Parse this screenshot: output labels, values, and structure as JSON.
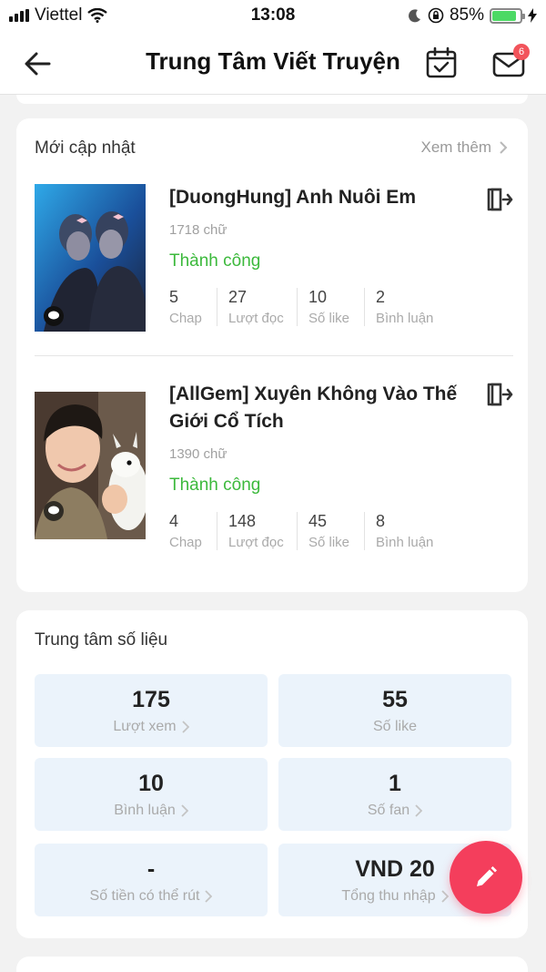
{
  "status_bar": {
    "carrier": "Viettel",
    "time": "13:08",
    "battery": "85%",
    "battery_level": 0.85
  },
  "header": {
    "title": "Trung Tâm Viết Truyện",
    "mail_badge": "6"
  },
  "updates": {
    "title": "Mới cập nhật",
    "see_more": "Xem thêm",
    "stories": [
      {
        "title": "[DuongHung] Anh Nuôi Em",
        "words": "1718 chữ",
        "status": "Thành công",
        "metrics": [
          {
            "value": "5",
            "label": "Chap"
          },
          {
            "value": "27",
            "label": "Lượt đọc"
          },
          {
            "value": "10",
            "label": "Số like"
          },
          {
            "value": "2",
            "label": "Bình luận"
          }
        ]
      },
      {
        "title": "[AllGem] Xuyên Không Vào Thế Giới Cổ Tích",
        "words": "1390 chữ",
        "status": "Thành công",
        "metrics": [
          {
            "value": "4",
            "label": "Chap"
          },
          {
            "value": "148",
            "label": "Lượt đọc"
          },
          {
            "value": "45",
            "label": "Số like"
          },
          {
            "value": "8",
            "label": "Bình luận"
          }
        ]
      }
    ]
  },
  "stats": {
    "title": "Trung tâm số liệu",
    "tiles": [
      {
        "value": "175",
        "label": "Lượt xem"
      },
      {
        "value": "55",
        "label": "Số like"
      },
      {
        "value": "10",
        "label": "Bình luận"
      },
      {
        "value": "1",
        "label": "Số fan"
      },
      {
        "value": "-",
        "label": "Số tiền có thể rút"
      },
      {
        "value": "VND 20",
        "label": "Tổng thu nhập"
      }
    ]
  },
  "icons": {
    "back": "arrow-left-icon",
    "calendar": "calendar-check-icon",
    "mail": "mail-icon",
    "exit": "exit-icon",
    "fab": "pencil-icon"
  },
  "colors": {
    "accent": "#f43e5c",
    "success": "#3cb93c",
    "tile_bg": "#ebf3fb"
  }
}
